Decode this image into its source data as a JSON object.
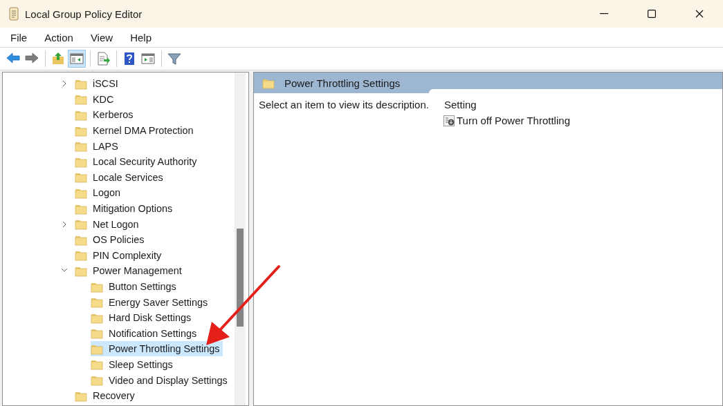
{
  "window": {
    "title": "Local Group Policy Editor"
  },
  "menu": [
    "File",
    "Action",
    "View",
    "Help"
  ],
  "toolbar": [
    {
      "kind": "back",
      "pressed": false
    },
    {
      "kind": "forward",
      "pressed": false
    },
    {
      "kind": "separator"
    },
    {
      "kind": "up",
      "pressed": false
    },
    {
      "kind": "tree",
      "pressed": true
    },
    {
      "kind": "separator"
    },
    {
      "kind": "export",
      "pressed": false
    },
    {
      "kind": "separator"
    },
    {
      "kind": "help",
      "pressed": false
    },
    {
      "kind": "pane",
      "pressed": false
    },
    {
      "kind": "separator"
    },
    {
      "kind": "filter",
      "pressed": false
    }
  ],
  "tree": [
    {
      "label": "iSCSI",
      "expanded": false,
      "selected": false
    },
    {
      "label": "KDC",
      "selected": false
    },
    {
      "label": "Kerberos",
      "selected": false
    },
    {
      "label": "Kernel DMA Protection",
      "selected": false
    },
    {
      "label": "LAPS",
      "selected": false
    },
    {
      "label": "Local Security Authority",
      "selected": false
    },
    {
      "label": "Locale Services",
      "selected": false
    },
    {
      "label": "Logon",
      "selected": false
    },
    {
      "label": "Mitigation Options",
      "selected": false
    },
    {
      "label": "Net Logon",
      "expanded": false,
      "selected": false
    },
    {
      "label": "OS Policies",
      "selected": false
    },
    {
      "label": "PIN Complexity",
      "selected": false
    },
    {
      "label": "Power Management",
      "expanded": true,
      "selected": false,
      "children": [
        {
          "label": "Button Settings",
          "selected": false
        },
        {
          "label": "Energy Saver Settings",
          "selected": false
        },
        {
          "label": "Hard Disk Settings",
          "selected": false
        },
        {
          "label": "Notification Settings",
          "selected": false
        },
        {
          "label": "Power Throttling Settings",
          "selected": true
        },
        {
          "label": "Sleep Settings",
          "selected": false
        },
        {
          "label": "Video and Display Settings",
          "selected": false
        }
      ]
    },
    {
      "label": "Recovery",
      "selected": false
    }
  ],
  "details": {
    "header": "Power Throttling Settings",
    "description": "Select an item to view its description.",
    "column": "Setting",
    "settings": [
      "Turn off Power Throttling"
    ]
  }
}
